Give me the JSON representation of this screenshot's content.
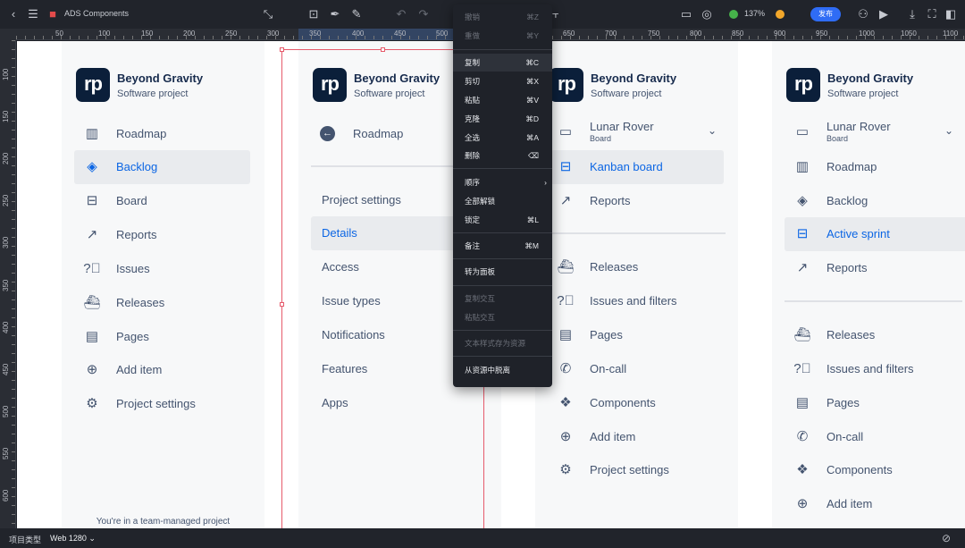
{
  "toolbar": {
    "title": "ADS Components",
    "zoom": "137%",
    "publish_label": "发布",
    "icons": [
      "chevron-left-icon",
      "menu-icon",
      "gift-icon",
      "connector-icon",
      "frame-add-icon",
      "pen-icon",
      "pencil-icon",
      "undo-icon",
      "redo-icon",
      "align-icon",
      "device-icon",
      "target-icon",
      "zoom-out-icon",
      "zoom-in-icon",
      "user-icon",
      "play-icon",
      "download-icon",
      "fullscreen-icon",
      "panel-icon"
    ]
  },
  "ruler": {
    "h_ticks": [
      "50",
      "100",
      "150",
      "200",
      "250",
      "300",
      "350",
      "400",
      "450",
      "500",
      "650",
      "700",
      "750",
      "800",
      "850",
      "900",
      "950",
      "1000",
      "1050",
      "1100"
    ],
    "v_ticks": [
      "100",
      "150",
      "200",
      "250",
      "300",
      "350",
      "400",
      "450",
      "500",
      "550",
      "600"
    ]
  },
  "panels": [
    {
      "title": "Beyond Gravity",
      "subtitle": "Software project",
      "logo": "rp",
      "items": [
        {
          "icon": "chart-icon",
          "label": "Roadmap",
          "selected": false
        },
        {
          "icon": "layers-icon",
          "label": "Backlog",
          "selected": true
        },
        {
          "icon": "board-icon",
          "label": "Board",
          "selected": false
        },
        {
          "icon": "trend-icon",
          "label": "Reports",
          "selected": false
        },
        {
          "icon": "question-icon",
          "label": "Issues",
          "selected": false
        },
        {
          "icon": "ship-icon",
          "label": "Releases",
          "selected": false
        },
        {
          "icon": "page-icon",
          "label": "Pages",
          "selected": false
        },
        {
          "icon": "plus-circle-icon",
          "label": "Add item",
          "selected": false
        },
        {
          "icon": "gear-icon",
          "label": "Project settings",
          "selected": false
        }
      ],
      "footer": "You're in a team-managed project"
    },
    {
      "title": "Beyond Gravity",
      "subtitle": "Software project",
      "logo": "rp",
      "back_label": "Roadmap",
      "items": [
        {
          "label": "Project settings",
          "selected": false
        },
        {
          "label": "Details",
          "selected": true
        },
        {
          "label": "Access",
          "selected": false
        },
        {
          "label": "Issue types",
          "selected": false
        },
        {
          "label": "Notifications",
          "selected": false
        },
        {
          "label": "Features",
          "selected": false
        },
        {
          "label": "Apps",
          "selected": false
        }
      ]
    },
    {
      "title": "Beyond Gravity",
      "subtitle": "Software project",
      "logo": "rp",
      "board_select": {
        "label": "Lunar Rover",
        "sub": "Board"
      },
      "items_top": [
        {
          "icon": "board-icon",
          "label": "Kanban board",
          "selected": true
        },
        {
          "icon": "trend-icon",
          "label": "Reports",
          "selected": false
        }
      ],
      "items": [
        {
          "icon": "ship-icon",
          "label": "Releases"
        },
        {
          "icon": "question-icon",
          "label": "Issues and filters"
        },
        {
          "icon": "page-icon",
          "label": "Pages"
        },
        {
          "icon": "phone-icon",
          "label": "On-call"
        },
        {
          "icon": "component-icon",
          "label": "Components"
        },
        {
          "icon": "plus-circle-icon",
          "label": "Add item"
        },
        {
          "icon": "gear-icon",
          "label": "Project settings"
        }
      ]
    },
    {
      "title": "Beyond Gravity",
      "subtitle": "Software project",
      "logo": "rp",
      "board_select": {
        "label": "Lunar Rover",
        "sub": "Board"
      },
      "items_top": [
        {
          "icon": "chart-icon",
          "label": "Roadmap",
          "selected": false
        },
        {
          "icon": "layers-icon",
          "label": "Backlog",
          "selected": false
        },
        {
          "icon": "board-icon",
          "label": "Active sprint",
          "selected": true
        },
        {
          "icon": "trend-icon",
          "label": "Reports",
          "selected": false
        }
      ],
      "items": [
        {
          "icon": "ship-icon",
          "label": "Releases"
        },
        {
          "icon": "question-icon",
          "label": "Issues and filters"
        },
        {
          "icon": "page-icon",
          "label": "Pages"
        },
        {
          "icon": "phone-icon",
          "label": "On-call"
        },
        {
          "icon": "component-icon",
          "label": "Components"
        },
        {
          "icon": "plus-circle-icon",
          "label": "Add item"
        }
      ]
    }
  ],
  "context_menu": {
    "groups": [
      [
        {
          "label": "撤销",
          "shortcut": "⌘Z",
          "disabled": true
        },
        {
          "label": "重做",
          "shortcut": "⌘Y",
          "disabled": true
        }
      ],
      [
        {
          "label": "复制",
          "shortcut": "⌘C",
          "highlighted": true
        },
        {
          "label": "剪切",
          "shortcut": "⌘X"
        },
        {
          "label": "粘贴",
          "shortcut": "⌘V"
        },
        {
          "label": "克隆",
          "shortcut": "⌘D"
        },
        {
          "label": "全选",
          "shortcut": "⌘A"
        },
        {
          "label": "删除",
          "shortcut": "⌫"
        }
      ],
      [
        {
          "label": "顺序",
          "shortcut": "›"
        },
        {
          "label": "全部解锁",
          "shortcut": ""
        },
        {
          "label": "锁定",
          "shortcut": "⌘L"
        }
      ],
      [
        {
          "label": "备注",
          "shortcut": "⌘M"
        }
      ],
      [
        {
          "label": "转为面板",
          "shortcut": ""
        }
      ],
      [
        {
          "label": "复制交互",
          "shortcut": "",
          "disabled": true
        },
        {
          "label": "粘贴交互",
          "shortcut": "",
          "disabled": true
        }
      ],
      [
        {
          "label": "文本样式存为资源",
          "shortcut": "",
          "disabled": true
        }
      ],
      [
        {
          "label": "从资源中脱离",
          "shortcut": ""
        }
      ]
    ]
  },
  "bottom": {
    "project_type_label": "项目类型",
    "device": "Web 1280 ⌄"
  },
  "colors": {
    "accent": "#0c66e4",
    "selection": "#e65a6b",
    "publish": "#2f6cf5"
  }
}
